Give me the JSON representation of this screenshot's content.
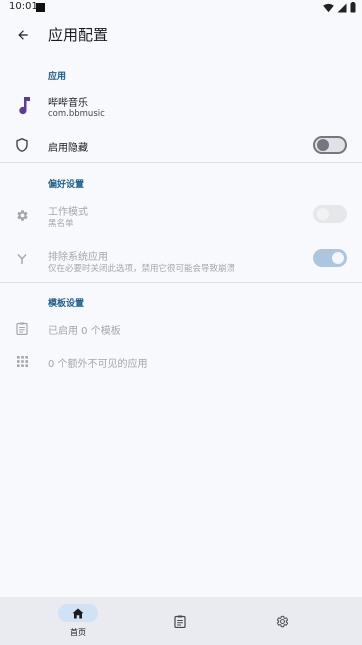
{
  "status_bar": {
    "time": "10:01"
  },
  "app_bar": {
    "title": "应用配置"
  },
  "sections": {
    "app": {
      "header": "应用",
      "app_name": "哔哔音乐",
      "package": "com.bbmusic",
      "enable_hide_label": "启用隐藏",
      "enable_hide_on": false
    },
    "preferences": {
      "header": "偏好设置",
      "work_mode_title": "工作模式",
      "work_mode_value": "黑名单",
      "work_mode_on": false,
      "exclude_system_title": "排除系统应用",
      "exclude_system_sub": "仅在必要时关闭此选项，禁用它很可能会导致崩溃",
      "exclude_system_on": true
    },
    "templates": {
      "header": "模板设置",
      "enabled_templates": "已启用 0 个模板",
      "extra_invisible_apps": "0 个额外不可见的应用"
    }
  },
  "bottom_nav": {
    "items": [
      {
        "label": "首页",
        "icon": "home-icon",
        "active": true
      },
      {
        "label": "",
        "icon": "clipboard-icon",
        "active": false
      },
      {
        "label": "",
        "icon": "gear-icon",
        "active": false
      }
    ]
  },
  "colors": {
    "accent": "#1f5f8f",
    "music_icon": "#5b3a9e",
    "background": "#f8f9fc",
    "nav_background": "#e9ebf1"
  }
}
